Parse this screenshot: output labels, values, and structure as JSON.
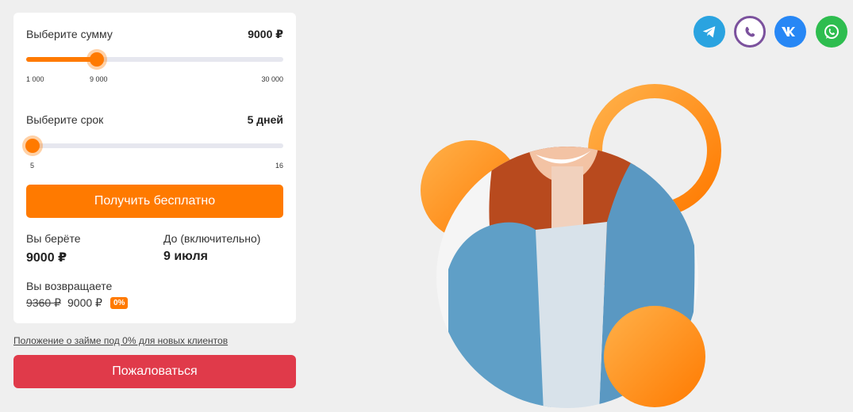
{
  "calculator": {
    "amount": {
      "label": "Выберите сумму",
      "value_text": "9000 ₽",
      "min_label": "1 000",
      "mid_label": "9 000",
      "max_label": "30 000",
      "min": 1000,
      "max": 30000,
      "value": 9000
    },
    "term": {
      "label": "Выберите срок",
      "value_text": "5 дней",
      "min_label": "5",
      "max_label": "16",
      "min": 5,
      "max": 16,
      "value": 5
    },
    "submit_label": "Получить бесплатно",
    "take": {
      "label": "Вы берёте",
      "value": "9000 ₽"
    },
    "until": {
      "label": "До (включительно)",
      "value": "9 июля"
    },
    "return": {
      "label": "Вы возвращаете",
      "old_value": "9360 ₽",
      "new_value": "9000 ₽",
      "badge": "0%"
    }
  },
  "terms_link": "Положение о займе под 0% для новых клиентов",
  "complaint_label": "Пожаловаться",
  "social": [
    "telegram-icon",
    "viber-icon",
    "vk-icon",
    "whatsapp-icon"
  ],
  "colors": {
    "accent": "#ff7a00",
    "complaint": "#e03a4a",
    "telegram": "#2aa3e0",
    "viber": "#7b519d",
    "vk": "#2787f5",
    "whatsapp": "#2ebd4f"
  }
}
